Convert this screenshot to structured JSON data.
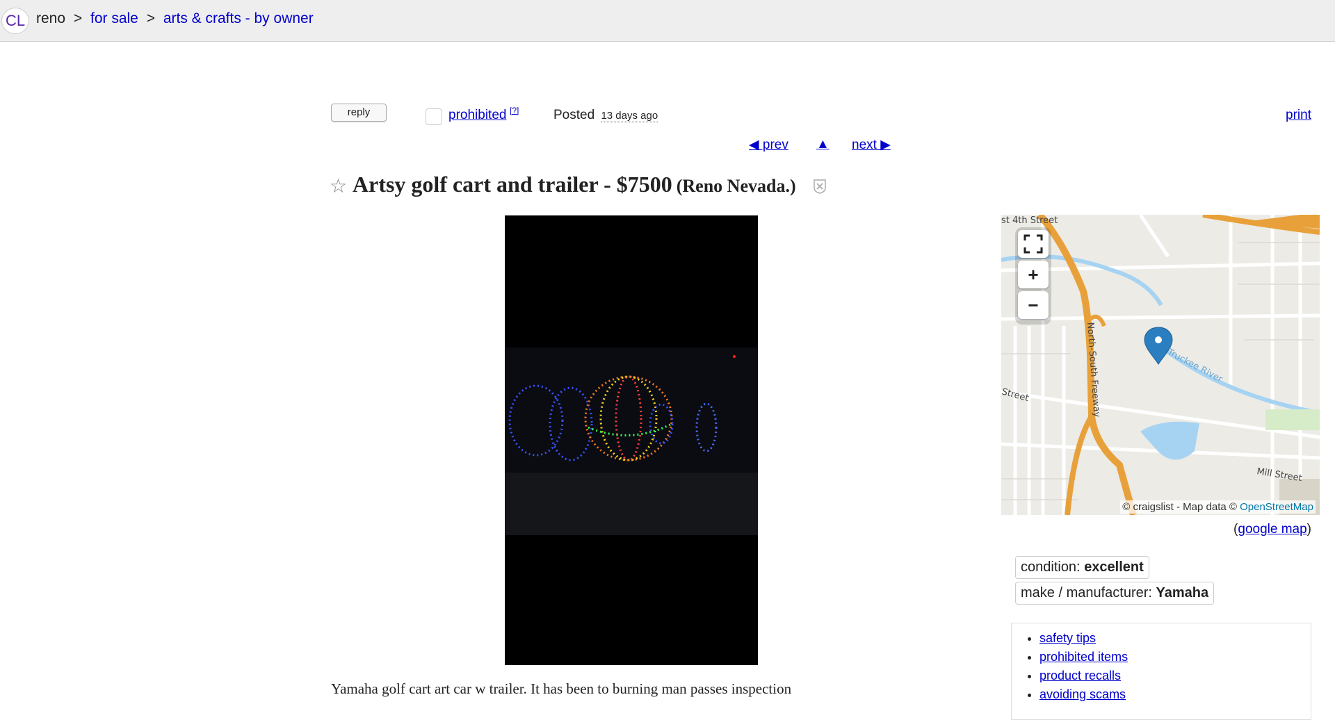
{
  "header": {
    "logo": "CL",
    "area": "reno",
    "breadcrumbs": [
      {
        "label": "for sale"
      },
      {
        "label": "arts & crafts - by owner"
      }
    ],
    "separator": ">"
  },
  "actions": {
    "reply": "reply",
    "prohibited": "prohibited",
    "help": "[?]",
    "posted_label": "Posted",
    "posted_ago": "13 days ago",
    "print": "print"
  },
  "nav": {
    "prev": "◀ prev",
    "up": "▲",
    "next": "next ▶"
  },
  "posting": {
    "star": "☆",
    "title": "Artsy golf cart and trailer - $7500",
    "location": "(Reno Nevada.)",
    "description": "Yamaha golf cart art car w trailer. It has been to burning man passes inspection"
  },
  "map": {
    "zoom_in": "+",
    "zoom_out": "−",
    "labels": {
      "street_top": "st 4th Street",
      "freeway": "North-South Freeway",
      "river": "Truckee River",
      "street_left": "Street",
      "mill": "Mill Street"
    },
    "attribution": "© craigslist - Map data ©",
    "attribution_link": "OpenStreetMap",
    "google_open": "(",
    "google_link": "google map",
    "google_close": ")"
  },
  "attributes": [
    {
      "label": "condition:",
      "value": "excellent"
    },
    {
      "label": "make / manufacturer:",
      "value": "Yamaha"
    }
  ],
  "safety_links": [
    "safety tips",
    "prohibited items",
    "product recalls",
    "avoiding scams"
  ],
  "colors": {
    "link": "#0000cc",
    "header_bg": "#eeeeee",
    "freeway": "#e8a13a",
    "water": "#a7d3f2",
    "marker": "#2b7fc1"
  }
}
